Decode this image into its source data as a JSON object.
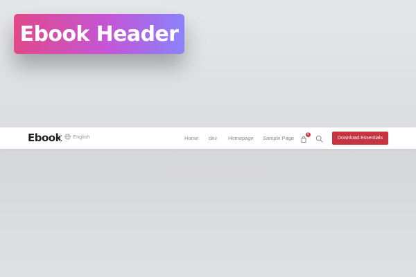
{
  "badge": {
    "title": "Ebook Header"
  },
  "header": {
    "logo": "Ebook",
    "language": {
      "label": "English",
      "icon": "globe-icon"
    },
    "nav": [
      {
        "label": "Home"
      },
      {
        "label": "dev"
      },
      {
        "label": "Homepage"
      },
      {
        "label": "Sample Page"
      }
    ],
    "cart": {
      "icon": "bag-icon",
      "count": "0"
    },
    "search": {
      "icon": "search-icon"
    },
    "cta_label": "Download Essentials"
  },
  "colors": {
    "accent": "#c5343f",
    "badge_gradient_start": "#e0498a",
    "badge_gradient_end": "#8a82fb"
  }
}
